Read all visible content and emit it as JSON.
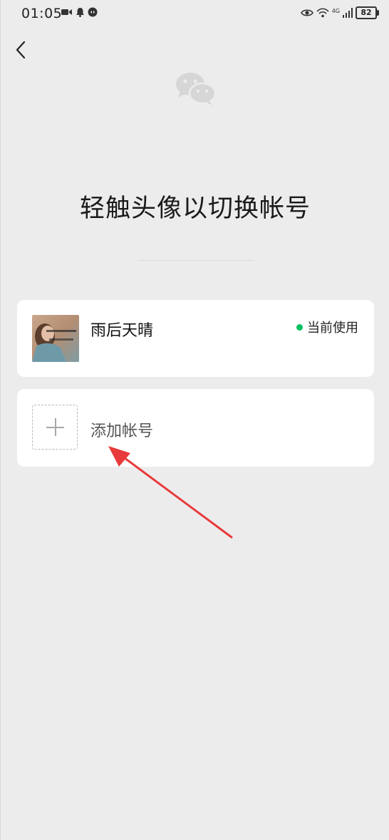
{
  "status_bar": {
    "time": "01:05",
    "battery": "82",
    "network": "4G"
  },
  "page": {
    "title": "轻触头像以切换帐号"
  },
  "accounts": [
    {
      "name": "雨后天晴",
      "status": "当前使用"
    }
  ],
  "add_account": {
    "label": "添加帐号"
  },
  "colors": {
    "background": "#EDECED",
    "card": "#FFFFFF",
    "active_dot": "#07C160",
    "annotation_arrow": "#E83A3A"
  }
}
